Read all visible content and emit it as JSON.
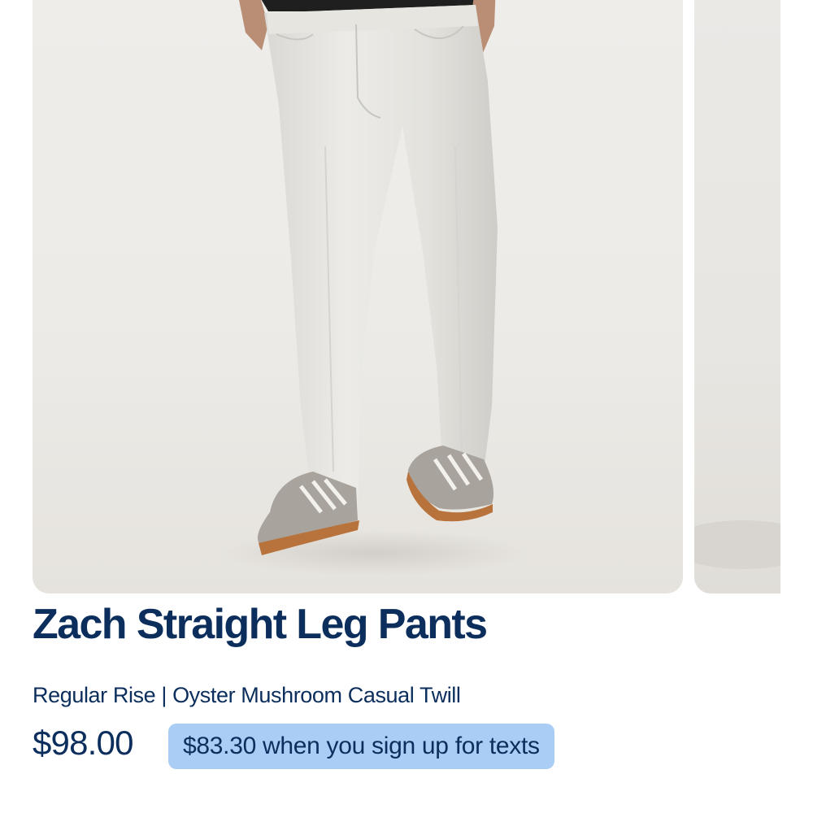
{
  "product": {
    "title": "Zach Straight Leg Pants",
    "subtitle": "Regular Rise | Oyster Mushroom Casual Twill",
    "price": "$98.00",
    "promo_text": "$83.30 when you sign up for texts"
  },
  "images": {
    "main": "product-photo-model-white-pants",
    "next": "product-photo-next-partial"
  },
  "colors": {
    "text_primary": "#0b2e5c",
    "promo_background": "#a9cdf5",
    "image_background": "#ecebe7"
  }
}
